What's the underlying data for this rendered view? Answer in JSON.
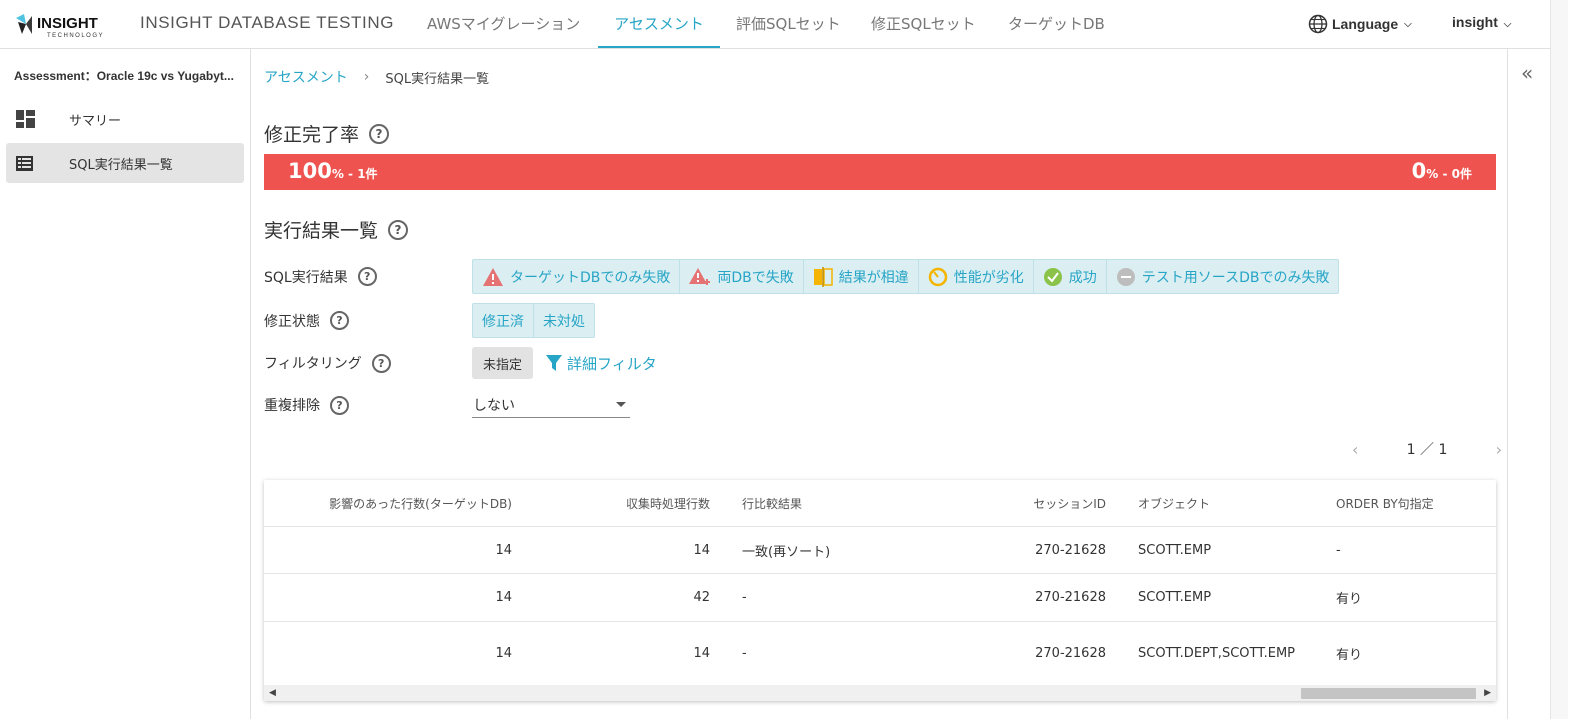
{
  "header": {
    "logo_text": "INSIGHT",
    "logo_subtext": "TECHNOLOGY",
    "app_title": "INSIGHT DATABASE TESTING",
    "tabs": [
      {
        "label": "AWSマイグレーション"
      },
      {
        "label": "アセスメント"
      },
      {
        "label": "評価SQLセット"
      },
      {
        "label": "修正SQLセット"
      },
      {
        "label": "ターゲットDB"
      }
    ],
    "active_tab": "アセスメント",
    "language_label": "Language",
    "user_label": "insight"
  },
  "sidebar": {
    "title": "Assessment：Oracle 19c vs Yugabyt...",
    "items": [
      {
        "label": "サマリー",
        "icon": "dashboard-icon"
      },
      {
        "label": "SQL実行結果一覧",
        "icon": "list-icon"
      }
    ]
  },
  "breadcrumb": {
    "link": "アセスメント",
    "separator": "›",
    "current": "SQL実行結果一覧"
  },
  "completion": {
    "title": "修正完了率",
    "done_percent": "100",
    "done_count": "% - 1件",
    "remaining_percent": "0",
    "remaining_count": "% - 0件",
    "bar_color": "#ef5350"
  },
  "results": {
    "title": "実行結果一覧",
    "sql_result_label": "SQL実行結果",
    "sql_result_options": [
      {
        "label": "ターゲットDBでのみ失敗",
        "icon": "warning-icon"
      },
      {
        "label": "両DBで失敗",
        "icon": "warning-plus-icon"
      },
      {
        "label": "結果が相違",
        "icon": "compare-icon"
      },
      {
        "label": "性能が劣化",
        "icon": "gauge-icon"
      },
      {
        "label": "成功",
        "icon": "check-circle-icon"
      },
      {
        "label": "テスト用ソースDBでのみ失敗",
        "icon": "minus-circle-icon"
      }
    ],
    "fix_status_label": "修正状態",
    "fix_status_options": [
      {
        "label": "修正済"
      },
      {
        "label": "未対処"
      }
    ],
    "filtering_label": "フィルタリング",
    "filtering_value": "未指定",
    "advanced_filter_label": "詳細フィルタ",
    "dedup_label": "重複排除",
    "dedup_value": "しない",
    "pager": {
      "text": "1 ／ 1"
    }
  },
  "table": {
    "columns": [
      "影響のあった行数(ターゲットDB)",
      "収集時処理行数",
      "行比較結果",
      "セッションID",
      "オブジェクト",
      "ORDER BY句指定"
    ],
    "rows": [
      [
        "14",
        "14",
        "一致(再ソート)",
        "270-21628",
        "SCOTT.EMP",
        "-"
      ],
      [
        "14",
        "42",
        "-",
        "270-21628",
        "SCOTT.EMP",
        "有り"
      ],
      [
        "14",
        "14",
        "-",
        "270-21628",
        "SCOTT.DEPT,SCOTT.EMP",
        "有り"
      ]
    ]
  },
  "colors": {
    "accent": "#27a5c6",
    "warning": "#e57373",
    "compare": "#f4b400",
    "success": "#8bc34a",
    "neutral": "#bdbdbd"
  }
}
